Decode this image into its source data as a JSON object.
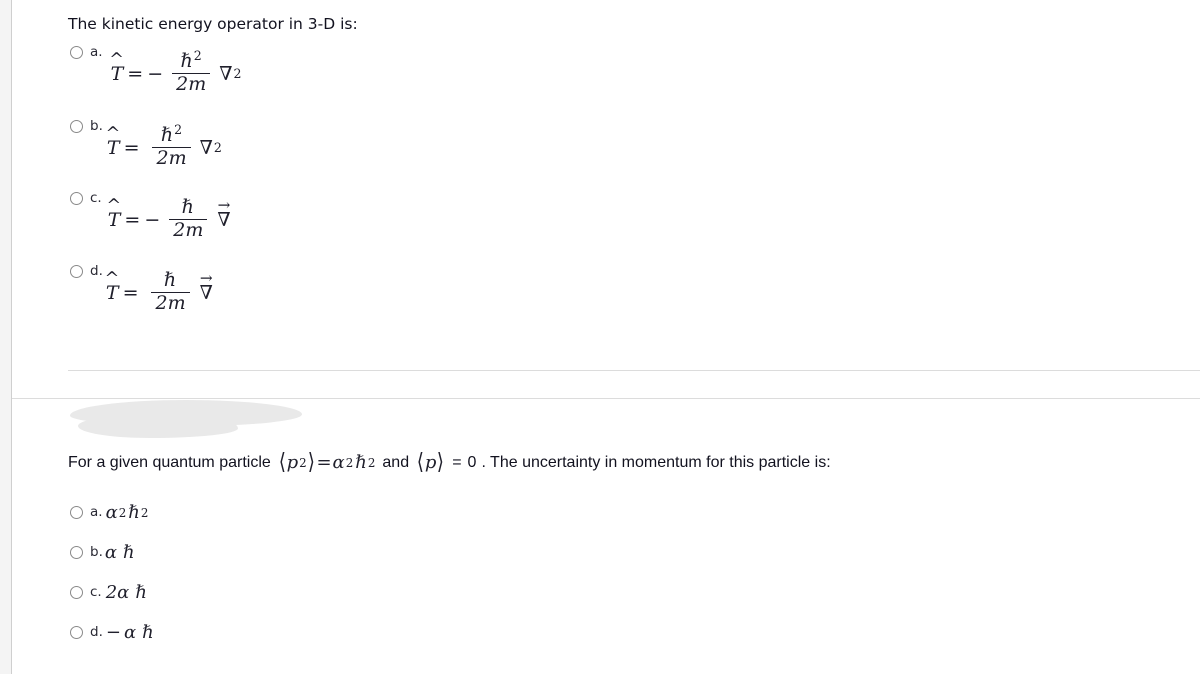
{
  "page": {
    "background": "#ffffff",
    "gutter_color": "#f4f4f4",
    "divider_color": "#dcdcdc",
    "smudge_color": "#e9e9e9",
    "text_color": "#1a1a2e"
  },
  "question1": {
    "stem": "The kinetic energy operator in 3-D is:",
    "options": [
      {
        "letter": "a.",
        "lhs": "T",
        "equals": "=",
        "sign": "−",
        "numerator": "ℏ",
        "numerator_exponent": "2",
        "denominator": "2m",
        "operator": "∇",
        "operator_exponent": "2",
        "operator_vector": false,
        "latex": "\\hat{T} = -\\frac{\\hbar^2}{2m}\\nabla^2"
      },
      {
        "letter": "b.",
        "lhs": "T",
        "equals": "=",
        "sign": "",
        "numerator": "ℏ",
        "numerator_exponent": "2",
        "denominator": "2m",
        "operator": "∇",
        "operator_exponent": "2",
        "operator_vector": false,
        "latex": "\\hat{T} = \\frac{\\hbar^2}{2m}\\nabla^2"
      },
      {
        "letter": "c.",
        "lhs": "T",
        "equals": "=",
        "sign": "−",
        "numerator": "ℏ",
        "numerator_exponent": "",
        "denominator": "2m",
        "operator": "∇",
        "operator_exponent": "",
        "operator_vector": true,
        "latex": "\\hat{T} = -\\frac{\\hbar}{2m}\\vec{\\nabla}"
      },
      {
        "letter": "d.",
        "lhs": "T",
        "equals": "=",
        "sign": "",
        "numerator": "ℏ",
        "numerator_exponent": "",
        "denominator": "2m",
        "operator": "∇",
        "operator_exponent": "",
        "operator_vector": true,
        "latex": "\\hat{T} = \\frac{\\hbar}{2m}\\vec{\\nabla}"
      }
    ]
  },
  "question2": {
    "stem_part1": "For a given quantum particle",
    "expect_p2_open": "⟨",
    "expect_p2_var": "p",
    "expect_p2_exp": "2",
    "expect_p2_close": "⟩",
    "expect_p2_equals": "=",
    "expect_p2_rhs_alpha": "α",
    "expect_p2_rhs_alpha_exp": "2",
    "expect_p2_rhs_hbar": "ℏ",
    "expect_p2_rhs_hbar_exp": "2",
    "stem_and": "and",
    "expect_p_open": "⟨",
    "expect_p_var": "p",
    "expect_p_close": "⟩",
    "expect_p_equals": "=",
    "expect_p_value": "0",
    "stem_part2": ". The uncertainty in momentum for this particle is:",
    "options": [
      {
        "letter": "a.",
        "coefficient": "",
        "alpha": "α",
        "alpha_exponent": "2",
        "hbar": "ℏ",
        "hbar_exponent": "2",
        "sign": "",
        "latex": "\\alpha^2\\hbar^2"
      },
      {
        "letter": "b.",
        "coefficient": "",
        "alpha": "α",
        "alpha_exponent": "",
        "hbar": "ℏ",
        "hbar_exponent": "",
        "sign": "",
        "latex": "\\alpha\\hbar"
      },
      {
        "letter": "c.",
        "coefficient": "2",
        "alpha": "α",
        "alpha_exponent": "",
        "hbar": "ℏ",
        "hbar_exponent": "",
        "sign": "",
        "latex": "2\\alpha\\hbar"
      },
      {
        "letter": "d.",
        "coefficient": "",
        "alpha": "α",
        "alpha_exponent": "",
        "hbar": "ℏ",
        "hbar_exponent": "",
        "sign": "−",
        "latex": "-\\alpha\\hbar"
      }
    ]
  }
}
